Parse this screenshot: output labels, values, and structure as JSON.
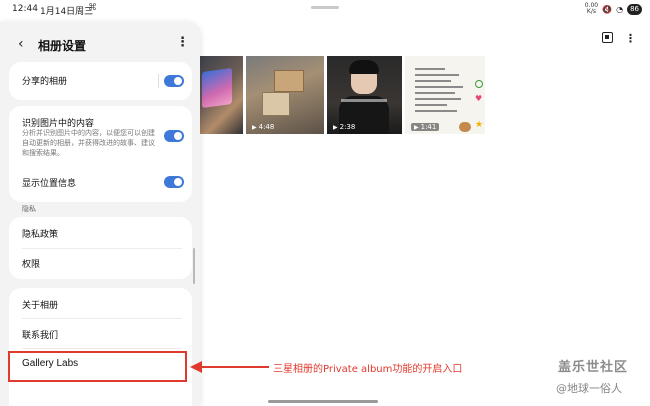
{
  "status_bar": {
    "time": "12:44",
    "date": "1月14日周三",
    "speed_top": "0.00",
    "speed_bottom": "K/s",
    "battery": "86"
  },
  "gallery": {
    "thumbnails": [
      {
        "duration": ""
      },
      {
        "duration": "4:48"
      },
      {
        "duration": "2:38"
      },
      {
        "duration": "1:41"
      }
    ]
  },
  "settings": {
    "title": "相册设置",
    "shared_albums": {
      "label": "分享的相册",
      "enabled": true
    },
    "identify_content": {
      "label": "识别图片中的内容",
      "description": "分析并识别图片中的内容，以便您可以创建自动更新的相册，并获得改进的故事、建议和搜索结果。",
      "enabled": true
    },
    "show_location": {
      "label": "显示位置信息",
      "enabled": true
    },
    "privacy_section": "隐私",
    "privacy_policy": "隐私政策",
    "permissions": "权限",
    "about_album": "关于相册",
    "contact_us": "联系我们",
    "gallery_labs": "Gallery Labs"
  },
  "annotation": {
    "text": "三星相册的Private album功能的开启入口",
    "color": "#e0392d"
  },
  "watermark": {
    "line1": "盖乐世社区",
    "line2": "@地球一俗人"
  },
  "colors": {
    "toggle_on": "#3e78d8",
    "panel_bg": "#f3f3f3"
  }
}
